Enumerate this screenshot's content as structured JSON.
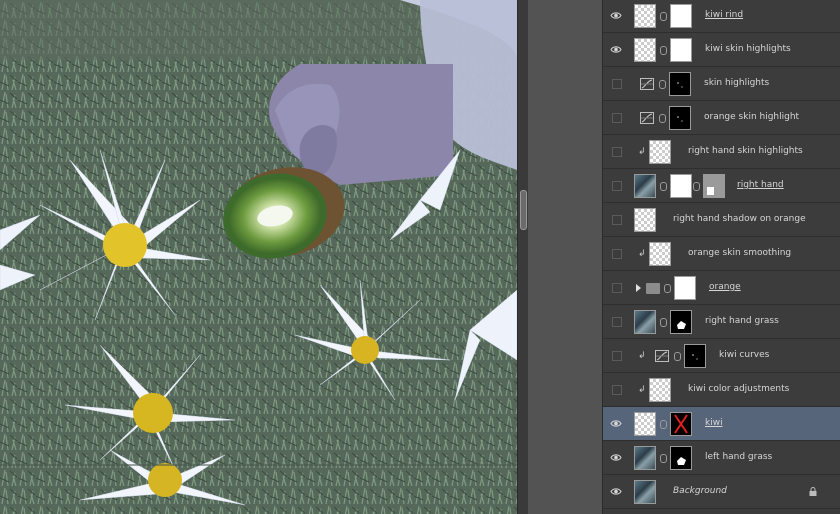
{
  "layers": [
    {
      "name": "kiwi rind",
      "underline": true,
      "italic": false,
      "visible": true,
      "clipped": false,
      "thumb": "checker",
      "mask": "white",
      "adjustment": false,
      "group": false,
      "lock": false,
      "selected": false
    },
    {
      "name": "kiwi skin highlights",
      "underline": false,
      "italic": false,
      "visible": true,
      "clipped": false,
      "thumb": "checker",
      "mask": "white",
      "adjustment": false,
      "group": false,
      "lock": false,
      "selected": false
    },
    {
      "name": "skin highlights",
      "underline": false,
      "italic": false,
      "visible": false,
      "clipped": false,
      "thumb": "adj",
      "mask": "black",
      "adjustment": true,
      "group": false,
      "lock": false,
      "selected": false
    },
    {
      "name": "orange skin highlight",
      "underline": false,
      "italic": false,
      "visible": false,
      "clipped": false,
      "thumb": "adj",
      "mask": "black",
      "adjustment": true,
      "group": false,
      "lock": false,
      "selected": false
    },
    {
      "name": "right hand skin highlights",
      "underline": false,
      "italic": false,
      "visible": false,
      "clipped": true,
      "thumb": "checker",
      "mask": null,
      "adjustment": false,
      "group": false,
      "lock": false,
      "selected": false
    },
    {
      "name": "right hand",
      "underline": true,
      "italic": false,
      "visible": false,
      "clipped": false,
      "thumb": "photo",
      "mask": "white",
      "mask2": "gray",
      "adjustment": false,
      "group": false,
      "lock": false,
      "selected": false
    },
    {
      "name": "right hand shadow on orange",
      "underline": false,
      "italic": false,
      "visible": false,
      "clipped": false,
      "thumb": "checker",
      "mask": null,
      "adjustment": false,
      "group": false,
      "lock": false,
      "selected": false
    },
    {
      "name": "orange skin smoothing",
      "underline": false,
      "italic": false,
      "visible": false,
      "clipped": true,
      "thumb": "checker",
      "mask": null,
      "adjustment": false,
      "group": false,
      "lock": false,
      "selected": false
    },
    {
      "name": "orange",
      "underline": true,
      "italic": false,
      "visible": false,
      "clipped": false,
      "thumb": "folder",
      "mask": "white",
      "adjustment": false,
      "group": true,
      "lock": false,
      "selected": false
    },
    {
      "name": "right hand grass",
      "underline": false,
      "italic": false,
      "visible": false,
      "clipped": false,
      "thumb": "photo",
      "mask": "black",
      "adjustment": false,
      "group": false,
      "lock": false,
      "selected": false
    },
    {
      "name": "kiwi curves",
      "underline": false,
      "italic": false,
      "visible": false,
      "clipped": true,
      "thumb": "adj",
      "mask": "black",
      "adjustment": true,
      "group": false,
      "lock": false,
      "selected": false
    },
    {
      "name": "kiwi color adjustments",
      "underline": false,
      "italic": false,
      "visible": false,
      "clipped": true,
      "thumb": "checker",
      "mask": null,
      "adjustment": false,
      "group": false,
      "lock": false,
      "selected": false
    },
    {
      "name": "kiwi",
      "underline": true,
      "italic": false,
      "visible": true,
      "clipped": false,
      "thumb": "checker",
      "mask": "black",
      "adjustment": false,
      "group": false,
      "lock": false,
      "selected": true
    },
    {
      "name": "left hand grass",
      "underline": false,
      "italic": false,
      "visible": true,
      "clipped": false,
      "thumb": "photo",
      "mask": "black",
      "adjustment": false,
      "group": false,
      "lock": false,
      "selected": false
    },
    {
      "name": "Background",
      "underline": false,
      "italic": true,
      "visible": true,
      "clipped": false,
      "thumb": "photo",
      "mask": null,
      "adjustment": false,
      "group": false,
      "lock": true,
      "selected": false
    }
  ],
  "icons": {
    "visibility": "eye-icon",
    "link": "chain-link-icon",
    "clip": "clipping-arrow-icon",
    "lock": "lock-icon",
    "group": "folder-icon",
    "expand": "expand-triangle-icon",
    "adjustment": "curves-adjustment-icon"
  }
}
